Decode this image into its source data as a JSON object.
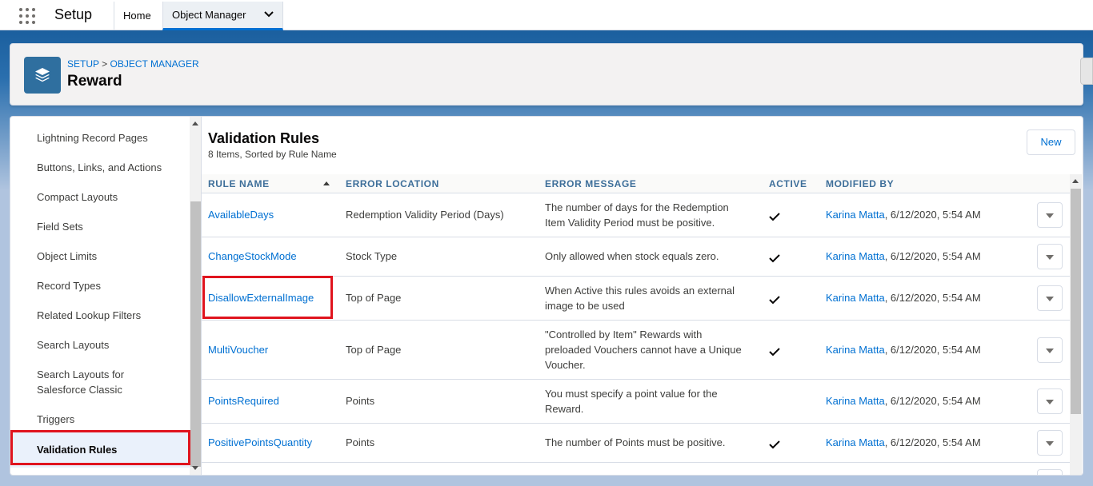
{
  "topbar": {
    "app_name": "Setup",
    "tabs": [
      {
        "label": "Home"
      },
      {
        "label": "Object Manager"
      }
    ]
  },
  "header": {
    "breadcrumb": {
      "part1": "SETUP",
      "separator": ">",
      "part2": "OBJECT MANAGER"
    },
    "title": "Reward"
  },
  "sidebar": {
    "items": [
      {
        "label": "Lightning Record Pages"
      },
      {
        "label": "Buttons, Links, and Actions"
      },
      {
        "label": "Compact Layouts"
      },
      {
        "label": "Field Sets"
      },
      {
        "label": "Object Limits"
      },
      {
        "label": "Record Types"
      },
      {
        "label": "Related Lookup Filters"
      },
      {
        "label": "Search Layouts"
      },
      {
        "label": "Search Layouts for",
        "label2": "Salesforce Classic"
      },
      {
        "label": "Triggers"
      },
      {
        "label": "Validation Rules",
        "active": true
      }
    ]
  },
  "main": {
    "title": "Validation Rules",
    "subtitle": "8 Items, Sorted by Rule Name",
    "new_button": "New",
    "columns": {
      "rule_name": "RULE NAME",
      "error_location": "ERROR LOCATION",
      "error_message": "ERROR MESSAGE",
      "active": "ACTIVE",
      "modified_by": "MODIFIED BY"
    },
    "rows": [
      {
        "name": "AvailableDays",
        "location": "Redemption Validity Period (Days)",
        "message": [
          "The number of days for the Redemption",
          "Item Validity Period must be positive."
        ],
        "active": true,
        "modified_by": "Karina Matta",
        "modified_date": ", 6/12/2020, 5:54 AM"
      },
      {
        "name": "ChangeStockMode",
        "location": "Stock Type",
        "message": [
          "Only allowed when stock equals zero."
        ],
        "active": true,
        "modified_by": "Karina Matta",
        "modified_date": ", 6/12/2020, 5:54 AM"
      },
      {
        "name": "DisallowExternalImage",
        "location": "Top of Page",
        "message": [
          "When Active this rules avoids an external",
          "image to be used"
        ],
        "active": true,
        "modified_by": "Karina Matta",
        "modified_date": ", 6/12/2020, 5:54 AM"
      },
      {
        "name": "MultiVoucher",
        "location": "Top of Page",
        "message": [
          "\"Controlled by Item\" Rewards with",
          "preloaded Vouchers cannot have a Unique",
          "Voucher."
        ],
        "active": true,
        "modified_by": "Karina Matta",
        "modified_date": ", 6/12/2020, 5:54 AM"
      },
      {
        "name": "PointsRequired",
        "location": "Points",
        "message": [
          "You must specify a point value for the",
          "Reward."
        ],
        "active": false,
        "modified_by": "Karina Matta",
        "modified_date": ", 6/12/2020, 5:54 AM"
      },
      {
        "name": "PositivePointsQuantity",
        "location": "Points",
        "message": [
          "The number of Points must be positive."
        ],
        "active": true,
        "modified_by": "Karina Matta",
        "modified_date": ", 6/12/2020, 5:54 AM"
      }
    ]
  },
  "colors": {
    "link": "#0070d2",
    "highlight": "#e0141e",
    "object_icon": "#2f6f9f",
    "active_item_bg": "#eaf1fb"
  },
  "icons": {
    "app_launcher": "waffle-icon",
    "object": "layers-icon",
    "active_check": "checkmark-icon",
    "row_menu": "chevron-down-icon"
  }
}
